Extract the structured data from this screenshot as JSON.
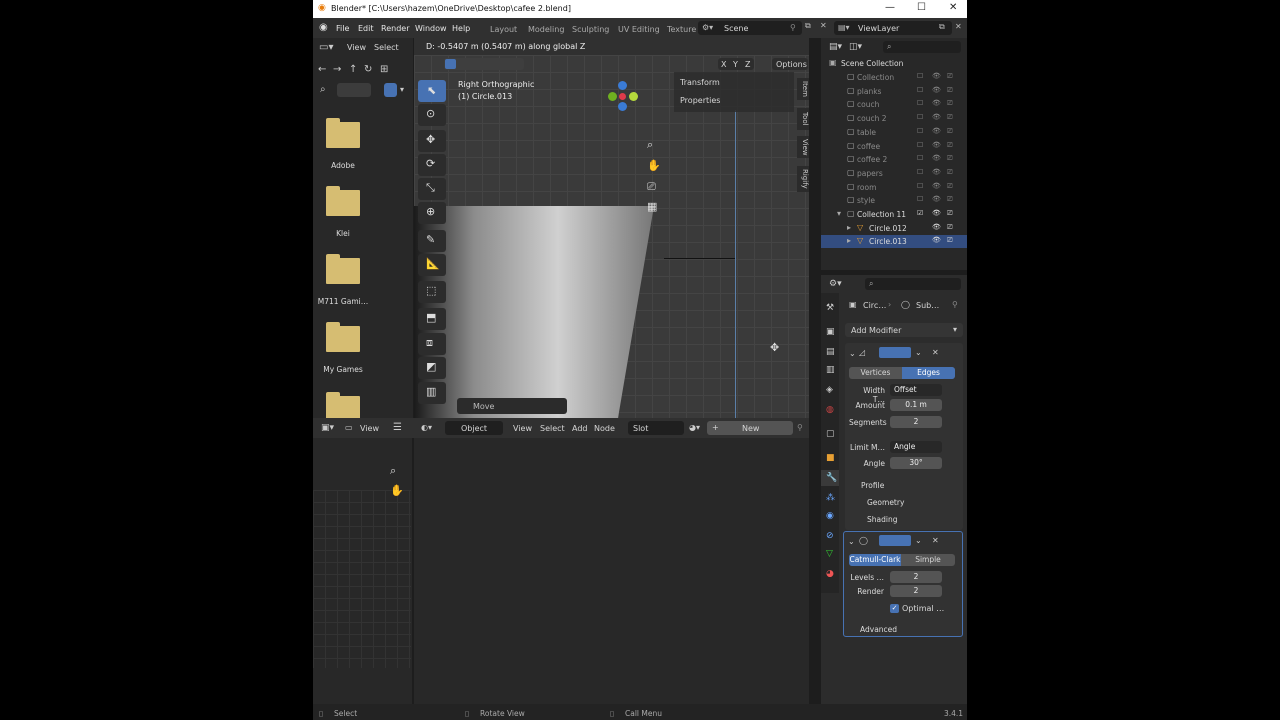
{
  "window": {
    "title": "Blender* [C:\\Users\\hazem\\OneDrive\\Desktop\\cafee 2.blend]",
    "min": "—",
    "max": "☐",
    "close": "✕"
  },
  "menu": {
    "file": "File",
    "edit": "Edit",
    "render": "Render",
    "window": "Window",
    "help": "Help"
  },
  "workspaces": [
    "Layout",
    "Modeling",
    "Sculpting",
    "UV Editing",
    "Texture"
  ],
  "scene": "Scene",
  "view_layer": "ViewLayer",
  "filebrowser": {
    "view": "View",
    "select": "Select",
    "folders": [
      "Adobe",
      "Klei",
      "M711 Gami…",
      "My Games",
      ""
    ]
  },
  "viewport": {
    "header_info": "D: -0.5407 m (0.5407 m) along global Z",
    "axes": [
      "X",
      "Y",
      "Z"
    ],
    "options": "Options",
    "view_name": "Right Orthographic",
    "object_name": "(1) Circle.013",
    "panel_transform": "Transform",
    "panel_properties": "Properties",
    "tabs": [
      "Item",
      "Tool",
      "View",
      "Rigify"
    ],
    "operator": "Move"
  },
  "node_editor": {
    "view": "View",
    "object": "Object",
    "view2": "View",
    "select": "Select",
    "add": "Add",
    "node": "Node",
    "slot": "Slot",
    "new": "New"
  },
  "outliner": {
    "scene_collection": "Scene Collection",
    "items": [
      "Collection",
      "planks",
      "couch",
      "couch 2",
      "table",
      "coffee",
      "coffee 2",
      "papers",
      "room",
      "style",
      "Collection 11",
      "Circle.012",
      "Circle.013"
    ]
  },
  "properties": {
    "breadcrumb_obj": "Circ…",
    "breadcrumb_mod": "Sub…",
    "add_modifier": "Add Modifier",
    "bevel": {
      "vertices": "Vertices",
      "edges": "Edges",
      "width_type_label": "Width T…",
      "width_type": "Offset",
      "amount_label": "Amount",
      "amount": "0.1 m",
      "segments_label": "Segments",
      "segments": "2",
      "limit_label": "Limit M…",
      "limit": "Angle",
      "angle_label": "Angle",
      "angle": "30°",
      "profile": "Profile",
      "geometry": "Geometry",
      "shading": "Shading"
    },
    "subsurf": {
      "catmull": "Catmull-Clark",
      "simple": "Simple",
      "levels_label": "Levels …",
      "levels": "2",
      "render_label": "Render",
      "render": "2",
      "optimal": "Optimal …",
      "advanced": "Advanced"
    }
  },
  "status": {
    "select": "Select",
    "rotate": "Rotate View",
    "call_menu": "Call Menu",
    "version": "3.4.1"
  },
  "colors": {
    "accent": "#4772b3",
    "folder": "#d6bd72"
  }
}
